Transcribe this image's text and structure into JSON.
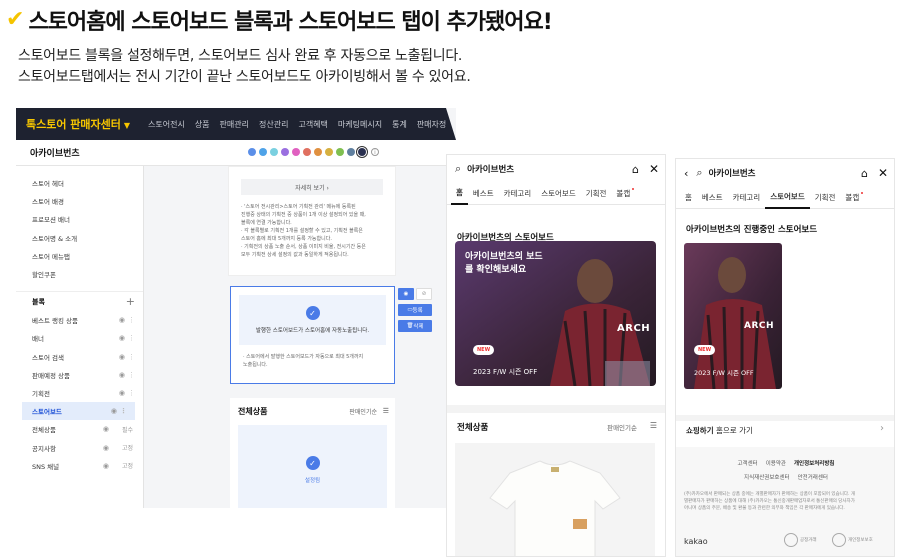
{
  "headline": {
    "check": "✔",
    "text": "스토어홈에 스토어보드 블록과 스토어보드 탭이 추가됐어요!"
  },
  "description": [
    "스토어보드 블록을 설정해두면, 스토어보드 심사 완료 후 자동으로 노출됩니다.",
    "스토어보드탭에서는 전시 기간이 끝난 스토어보드도 아카이빙해서 볼 수 있어요."
  ],
  "admin": {
    "brand": "톡스토어 판매자센터",
    "nav": [
      "스토어전시",
      "상품",
      "판매관리",
      "정산관리",
      "고객혜택",
      "마케팅메시지",
      "통계",
      "판매자정"
    ],
    "store_name": "아카이브번츠",
    "theme_colors": [
      "#5b8fe8",
      "#4fa3e8",
      "#7ad0e0",
      "#9a6fe0",
      "#e060c0",
      "#e07060",
      "#e09040",
      "#d6b040",
      "#7fbf50",
      "#5f7f9f",
      "#2a3050"
    ],
    "sidebar_top": [
      "스토어 헤더",
      "스토어 배경",
      "프로모션 배너",
      "스토어명 & 소개",
      "스토어 메뉴탭",
      "할인쿠폰"
    ],
    "block_header": "블록",
    "blocks": [
      {
        "label": "베스트 랭킹 상품"
      },
      {
        "label": "배너"
      },
      {
        "label": "스토어 검색"
      },
      {
        "label": "판매예정 상품"
      },
      {
        "label": "기획전"
      },
      {
        "label": "스토어보드",
        "highlight": true
      },
      {
        "label": "전체상품",
        "tag": "필수"
      },
      {
        "label": "공지사항",
        "tag": "고정"
      },
      {
        "label": "SNS 채널",
        "tag": "고정"
      }
    ],
    "detail_button": "자세히 보기 ›",
    "notes": [
      "· '스토어 전시관리>스토어 기획전 관리' 메뉴에 등록된",
      "  진행중 상태의 기획전 중 상품이 1개 이상 설정되어 있을 때,",
      "  블록에 연결 가능합니다.",
      "· 각 블록별로 기획전 1개를 설정할 수 있고, 기획전 블록은",
      "  스토어 홈에 최대 5개까지 등록 가능합니다.",
      "· 기획전의 상품 노출 순서, 상품 이미지 비율, 전시기간 등은",
      "  모두 기획전 상세 설정의 값과 동일하게 적용됩니다."
    ],
    "selected_text": "발행한 스토어보드가 스토어홈에 자동노출됩니다.",
    "selected_note": [
      "· 스토어에서 발행한 스토어보드가 자동으로 최대 5개까지",
      "  노출됩니다."
    ],
    "tool_register": "등록",
    "tool_delete": "삭제",
    "all_products": "전체상품",
    "sort": "판매인기순",
    "setting_text": "설정됨"
  },
  "phone1": {
    "title": "아카이브번츠",
    "tabs": [
      "홈",
      "베스트",
      "카테고리",
      "스토어보드",
      "기획전",
      "볼캡"
    ],
    "active_tab": 0,
    "section_title": "아카이브번츠의 스토어보드",
    "promo_title": [
      "아카이브번츠의 보드",
      "를 확인해보세요"
    ],
    "brand_text": "ARCH",
    "new_badge": "NEW",
    "season": "2023 F/W 시즌 OFF",
    "all_products": "전체상품",
    "sort": "판매인기순"
  },
  "phone2": {
    "title": "아카이브번츠",
    "tabs": [
      "홈",
      "베스트",
      "카테고리",
      "스토어보드",
      "기획전",
      "볼캡"
    ],
    "active_tab": 3,
    "section_title": "아카이브번츠의 진행중인 스토어보드",
    "brand_text": "ARCH",
    "new_badge": "NEW",
    "season": "2023 F/W 시즌 OFF",
    "shop_link_bold": "쇼핑하기",
    "shop_link_rest": " 홈으로 가기",
    "footer_links": [
      "고객센터",
      "이용약관",
      "개인정보처리방침"
    ],
    "footer_links2": [
      "지식재산권보호센터",
      "안전거래센터"
    ],
    "footer_text": [
      "(주)카카오에서 판매되는 상품 중에는 개별판매자가 판매하는 상품이 포함되어 있습니다. 개",
      "별판매자가 판매하는 상품에 대해 (주)카카오는 통신중개판매업자로서 통신판매의 당사자가",
      "아니며 상품의 주문, 배송 및 환불 등과 관련한 의무와 책임은 각 판매자에게 있습니다."
    ],
    "kakao": "kakao",
    "seal1": "공정거래",
    "seal2": "개인정보보호"
  }
}
